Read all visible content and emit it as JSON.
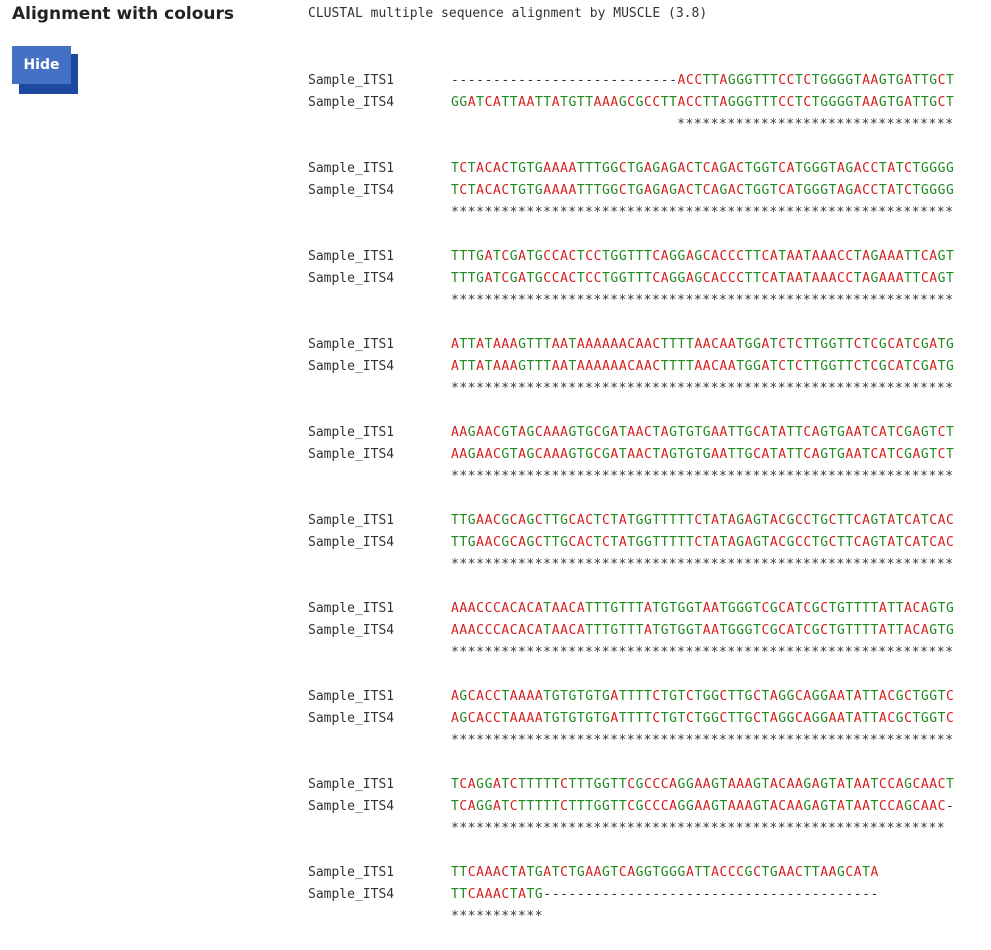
{
  "section": {
    "title": "Alignment with colours",
    "hide_button_label": "Hide"
  },
  "alignment": {
    "header": "CLUSTAL multiple sequence alignment by MUSCLE (3.8)",
    "colors": {
      "A": "#d42020",
      "C": "#d42020",
      "G": "#1f8a1f",
      "T": "#1f8a1f",
      "gap": "#333333"
    },
    "blocks": [
      {
        "rows": [
          {
            "name": "Sample_ITS1",
            "seq": "---------------------------ACCTTAGGGTTTCCTCTGGGGTAAGTGATTGCT"
          },
          {
            "name": "Sample_ITS4",
            "seq": "GGATCATTAATTATGTTAAAGCGCCTTACCTTAGGGTTTCCTCTGGGGTAAGTGATTGCT"
          }
        ],
        "consensus": "                           *********************************"
      },
      {
        "rows": [
          {
            "name": "Sample_ITS1",
            "seq": "TCTACACTGTGAAAATTTGGCTGAGAGACTCAGACTGGTCATGGGTAGACCTATCTGGGG"
          },
          {
            "name": "Sample_ITS4",
            "seq": "TCTACACTGTGAAAATTTGGCTGAGAGACTCAGACTGGTCATGGGTAGACCTATCTGGGG"
          }
        ],
        "consensus": "************************************************************"
      },
      {
        "rows": [
          {
            "name": "Sample_ITS1",
            "seq": "TTTGATCGATGCCACTCCTGGTTTCAGGAGCACCCTTCATAATAAACCTAGAAATTCAGT"
          },
          {
            "name": "Sample_ITS4",
            "seq": "TTTGATCGATGCCACTCCTGGTTTCAGGAGCACCCTTCATAATAAACCTAGAAATTCAGT"
          }
        ],
        "consensus": "************************************************************"
      },
      {
        "rows": [
          {
            "name": "Sample_ITS1",
            "seq": "ATTATAAAGTTTAATAAAAAACAACTTTTAACAATGGATCTCTTGGTTCTCGCATCGATG"
          },
          {
            "name": "Sample_ITS4",
            "seq": "ATTATAAAGTTTAATAAAAAACAACTTTTAACAATGGATCTCTTGGTTCTCGCATCGATG"
          }
        ],
        "consensus": "************************************************************"
      },
      {
        "rows": [
          {
            "name": "Sample_ITS1",
            "seq": "AAGAACGTAGCAAAGTGCGATAACTAGTGTGAATTGCATATTCAGTGAATCATCGAGTCT"
          },
          {
            "name": "Sample_ITS4",
            "seq": "AAGAACGTAGCAAAGTGCGATAACTAGTGTGAATTGCATATTCAGTGAATCATCGAGTCT"
          }
        ],
        "consensus": "************************************************************"
      },
      {
        "rows": [
          {
            "name": "Sample_ITS1",
            "seq": "TTGAACGCAGCTTGCACTCTATGGTTTTTCTATAGAGTACGCCTGCTTCAGTATCATCAC"
          },
          {
            "name": "Sample_ITS4",
            "seq": "TTGAACGCAGCTTGCACTCTATGGTTTTTCTATAGAGTACGCCTGCTTCAGTATCATCAC"
          }
        ],
        "consensus": "************************************************************"
      },
      {
        "rows": [
          {
            "name": "Sample_ITS1",
            "seq": "AAACCCACACATAACATTTGTTTATGTGGTAATGGGTCGCATCGCTGTTTTATTACAGTG"
          },
          {
            "name": "Sample_ITS4",
            "seq": "AAACCCACACATAACATTTGTTTATGTGGTAATGGGTCGCATCGCTGTTTTATTACAGTG"
          }
        ],
        "consensus": "************************************************************"
      },
      {
        "rows": [
          {
            "name": "Sample_ITS1",
            "seq": "AGCACCTAAAATGTGTGTGATTTTCTGTCTGGCTTGCTAGGCAGGAATATTACGCTGGTC"
          },
          {
            "name": "Sample_ITS4",
            "seq": "AGCACCTAAAATGTGTGTGATTTTCTGTCTGGCTTGCTAGGCAGGAATATTACGCTGGTC"
          }
        ],
        "consensus": "************************************************************"
      },
      {
        "rows": [
          {
            "name": "Sample_ITS1",
            "seq": "TCAGGATCTTTTTCTTTGGTTCGCCCAGGAAGTAAAGTACAAGAGTATAATCCAGCAACT"
          },
          {
            "name": "Sample_ITS4",
            "seq": "TCAGGATCTTTTTCTTTGGTTCGCCCAGGAAGTAAAGTACAAGAGTATAATCCAGCAAC-"
          }
        ],
        "consensus": "***********************************************************"
      },
      {
        "rows": [
          {
            "name": "Sample_ITS1",
            "seq": "TTCAAACTATGATCTGAAGTCAGGTGGGATTACCCGCTGAACTTAAGCATA"
          },
          {
            "name": "Sample_ITS4",
            "seq": "TTCAAACTATG----------------------------------------"
          }
        ],
        "consensus": "***********"
      }
    ]
  }
}
